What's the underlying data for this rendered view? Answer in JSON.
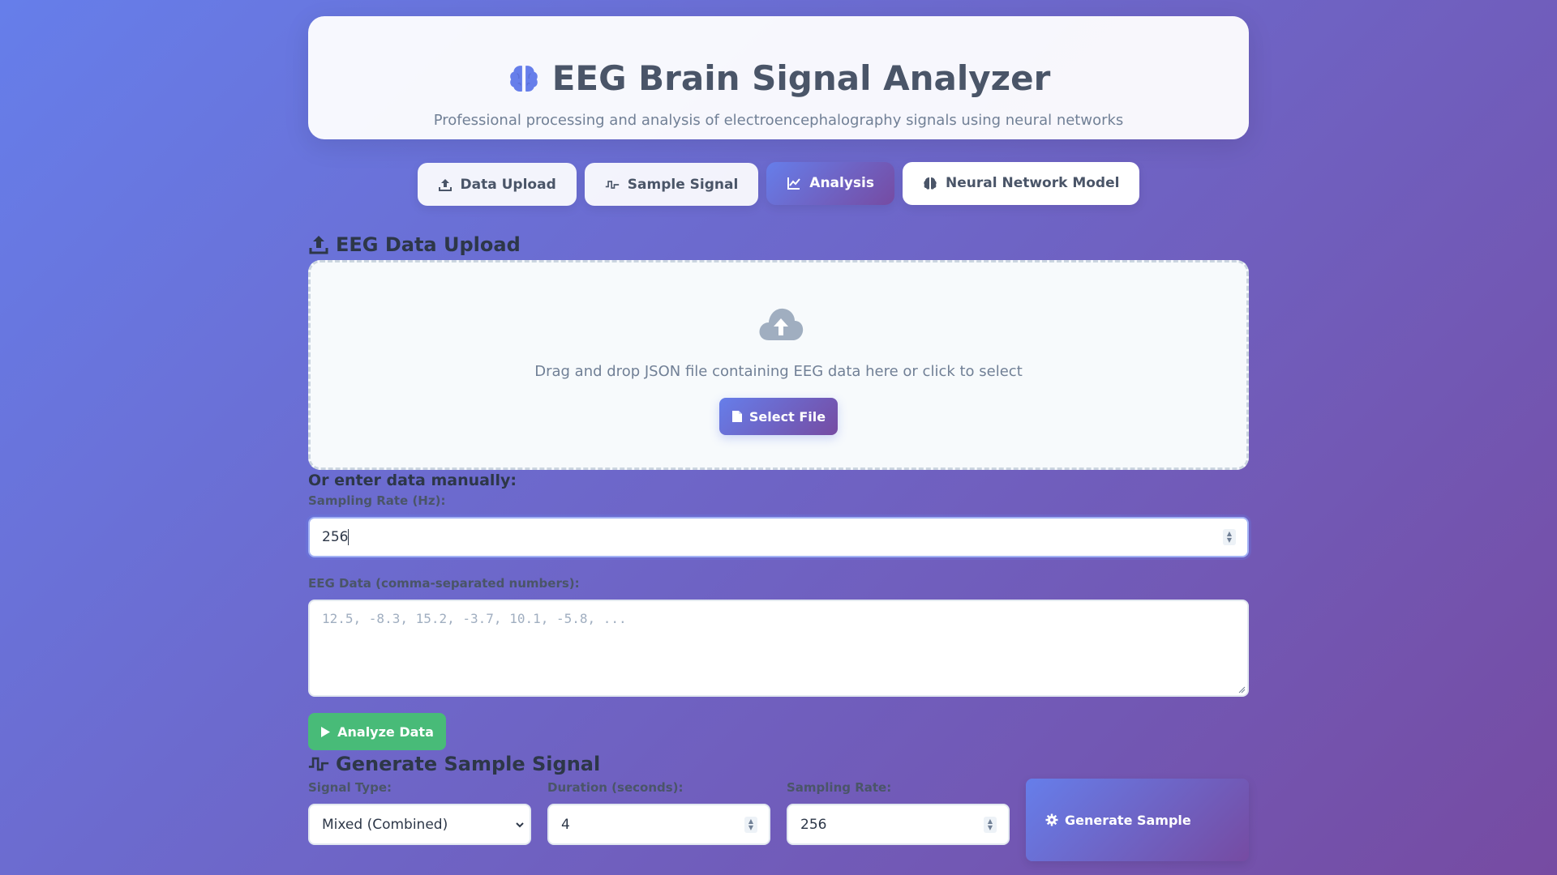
{
  "header": {
    "title": "EEG Brain Signal Analyzer",
    "subtitle": "Professional processing and analysis of electroencephalography signals using neural networks",
    "icon": "brain-icon"
  },
  "tabs": [
    {
      "label": "Data Upload",
      "icon": "upload-icon",
      "active": false
    },
    {
      "label": "Sample Signal",
      "icon": "wave-icon",
      "active": false
    },
    {
      "label": "Analysis",
      "icon": "chart-line-icon",
      "active": true
    },
    {
      "label": "Neural Network Model",
      "icon": "brain-icon",
      "active": false
    }
  ],
  "upload": {
    "title": "EEG Data Upload",
    "drop_text": "Drag and drop JSON file containing EEG data here or click to select",
    "select_button": "Select File"
  },
  "manual": {
    "title": "Or enter data manually:",
    "sampling_label": "Sampling Rate (Hz):",
    "sampling_value": "256",
    "data_label": "EEG Data (comma-separated numbers):",
    "data_placeholder": "12.5, -8.3, 15.2, -3.7, 10.1, -5.8, ...",
    "data_value": "",
    "analyze_button": "Analyze Data"
  },
  "sample": {
    "title": "Generate Sample Signal",
    "signal_type_label": "Signal Type:",
    "signal_type_value": "Mixed (Combined)",
    "duration_label": "Duration (seconds):",
    "duration_value": "4",
    "rate_label": "Sampling Rate:",
    "rate_value": "256",
    "generate_button": "Generate Sample"
  },
  "colors": {
    "gradient_start": "#667eea",
    "gradient_end": "#764ba2",
    "analyze_green": "#48bb78"
  }
}
